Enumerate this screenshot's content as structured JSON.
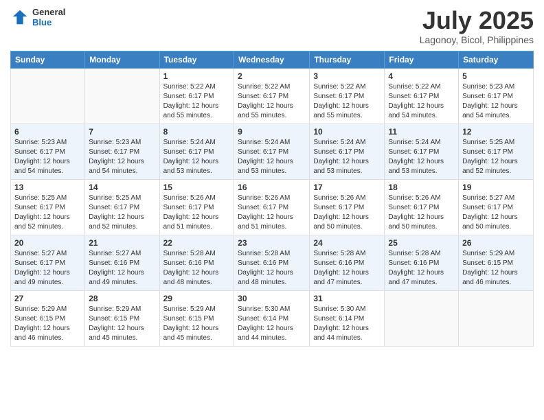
{
  "logo": {
    "general": "General",
    "blue": "Blue"
  },
  "header": {
    "month_year": "July 2025",
    "location": "Lagonoy, Bicol, Philippines"
  },
  "days_of_week": [
    "Sunday",
    "Monday",
    "Tuesday",
    "Wednesday",
    "Thursday",
    "Friday",
    "Saturday"
  ],
  "weeks": [
    [
      {
        "day": "",
        "sunrise": "",
        "sunset": "",
        "daylight": ""
      },
      {
        "day": "",
        "sunrise": "",
        "sunset": "",
        "daylight": ""
      },
      {
        "day": "1",
        "sunrise": "Sunrise: 5:22 AM",
        "sunset": "Sunset: 6:17 PM",
        "daylight": "Daylight: 12 hours and 55 minutes."
      },
      {
        "day": "2",
        "sunrise": "Sunrise: 5:22 AM",
        "sunset": "Sunset: 6:17 PM",
        "daylight": "Daylight: 12 hours and 55 minutes."
      },
      {
        "day": "3",
        "sunrise": "Sunrise: 5:22 AM",
        "sunset": "Sunset: 6:17 PM",
        "daylight": "Daylight: 12 hours and 55 minutes."
      },
      {
        "day": "4",
        "sunrise": "Sunrise: 5:22 AM",
        "sunset": "Sunset: 6:17 PM",
        "daylight": "Daylight: 12 hours and 54 minutes."
      },
      {
        "day": "5",
        "sunrise": "Sunrise: 5:23 AM",
        "sunset": "Sunset: 6:17 PM",
        "daylight": "Daylight: 12 hours and 54 minutes."
      }
    ],
    [
      {
        "day": "6",
        "sunrise": "Sunrise: 5:23 AM",
        "sunset": "Sunset: 6:17 PM",
        "daylight": "Daylight: 12 hours and 54 minutes."
      },
      {
        "day": "7",
        "sunrise": "Sunrise: 5:23 AM",
        "sunset": "Sunset: 6:17 PM",
        "daylight": "Daylight: 12 hours and 54 minutes."
      },
      {
        "day": "8",
        "sunrise": "Sunrise: 5:24 AM",
        "sunset": "Sunset: 6:17 PM",
        "daylight": "Daylight: 12 hours and 53 minutes."
      },
      {
        "day": "9",
        "sunrise": "Sunrise: 5:24 AM",
        "sunset": "Sunset: 6:17 PM",
        "daylight": "Daylight: 12 hours and 53 minutes."
      },
      {
        "day": "10",
        "sunrise": "Sunrise: 5:24 AM",
        "sunset": "Sunset: 6:17 PM",
        "daylight": "Daylight: 12 hours and 53 minutes."
      },
      {
        "day": "11",
        "sunrise": "Sunrise: 5:24 AM",
        "sunset": "Sunset: 6:17 PM",
        "daylight": "Daylight: 12 hours and 53 minutes."
      },
      {
        "day": "12",
        "sunrise": "Sunrise: 5:25 AM",
        "sunset": "Sunset: 6:17 PM",
        "daylight": "Daylight: 12 hours and 52 minutes."
      }
    ],
    [
      {
        "day": "13",
        "sunrise": "Sunrise: 5:25 AM",
        "sunset": "Sunset: 6:17 PM",
        "daylight": "Daylight: 12 hours and 52 minutes."
      },
      {
        "day": "14",
        "sunrise": "Sunrise: 5:25 AM",
        "sunset": "Sunset: 6:17 PM",
        "daylight": "Daylight: 12 hours and 52 minutes."
      },
      {
        "day": "15",
        "sunrise": "Sunrise: 5:26 AM",
        "sunset": "Sunset: 6:17 PM",
        "daylight": "Daylight: 12 hours and 51 minutes."
      },
      {
        "day": "16",
        "sunrise": "Sunrise: 5:26 AM",
        "sunset": "Sunset: 6:17 PM",
        "daylight": "Daylight: 12 hours and 51 minutes."
      },
      {
        "day": "17",
        "sunrise": "Sunrise: 5:26 AM",
        "sunset": "Sunset: 6:17 PM",
        "daylight": "Daylight: 12 hours and 50 minutes."
      },
      {
        "day": "18",
        "sunrise": "Sunrise: 5:26 AM",
        "sunset": "Sunset: 6:17 PM",
        "daylight": "Daylight: 12 hours and 50 minutes."
      },
      {
        "day": "19",
        "sunrise": "Sunrise: 5:27 AM",
        "sunset": "Sunset: 6:17 PM",
        "daylight": "Daylight: 12 hours and 50 minutes."
      }
    ],
    [
      {
        "day": "20",
        "sunrise": "Sunrise: 5:27 AM",
        "sunset": "Sunset: 6:17 PM",
        "daylight": "Daylight: 12 hours and 49 minutes."
      },
      {
        "day": "21",
        "sunrise": "Sunrise: 5:27 AM",
        "sunset": "Sunset: 6:16 PM",
        "daylight": "Daylight: 12 hours and 49 minutes."
      },
      {
        "day": "22",
        "sunrise": "Sunrise: 5:28 AM",
        "sunset": "Sunset: 6:16 PM",
        "daylight": "Daylight: 12 hours and 48 minutes."
      },
      {
        "day": "23",
        "sunrise": "Sunrise: 5:28 AM",
        "sunset": "Sunset: 6:16 PM",
        "daylight": "Daylight: 12 hours and 48 minutes."
      },
      {
        "day": "24",
        "sunrise": "Sunrise: 5:28 AM",
        "sunset": "Sunset: 6:16 PM",
        "daylight": "Daylight: 12 hours and 47 minutes."
      },
      {
        "day": "25",
        "sunrise": "Sunrise: 5:28 AM",
        "sunset": "Sunset: 6:16 PM",
        "daylight": "Daylight: 12 hours and 47 minutes."
      },
      {
        "day": "26",
        "sunrise": "Sunrise: 5:29 AM",
        "sunset": "Sunset: 6:15 PM",
        "daylight": "Daylight: 12 hours and 46 minutes."
      }
    ],
    [
      {
        "day": "27",
        "sunrise": "Sunrise: 5:29 AM",
        "sunset": "Sunset: 6:15 PM",
        "daylight": "Daylight: 12 hours and 46 minutes."
      },
      {
        "day": "28",
        "sunrise": "Sunrise: 5:29 AM",
        "sunset": "Sunset: 6:15 PM",
        "daylight": "Daylight: 12 hours and 45 minutes."
      },
      {
        "day": "29",
        "sunrise": "Sunrise: 5:29 AM",
        "sunset": "Sunset: 6:15 PM",
        "daylight": "Daylight: 12 hours and 45 minutes."
      },
      {
        "day": "30",
        "sunrise": "Sunrise: 5:30 AM",
        "sunset": "Sunset: 6:14 PM",
        "daylight": "Daylight: 12 hours and 44 minutes."
      },
      {
        "day": "31",
        "sunrise": "Sunrise: 5:30 AM",
        "sunset": "Sunset: 6:14 PM",
        "daylight": "Daylight: 12 hours and 44 minutes."
      },
      {
        "day": "",
        "sunrise": "",
        "sunset": "",
        "daylight": ""
      },
      {
        "day": "",
        "sunrise": "",
        "sunset": "",
        "daylight": ""
      }
    ]
  ]
}
